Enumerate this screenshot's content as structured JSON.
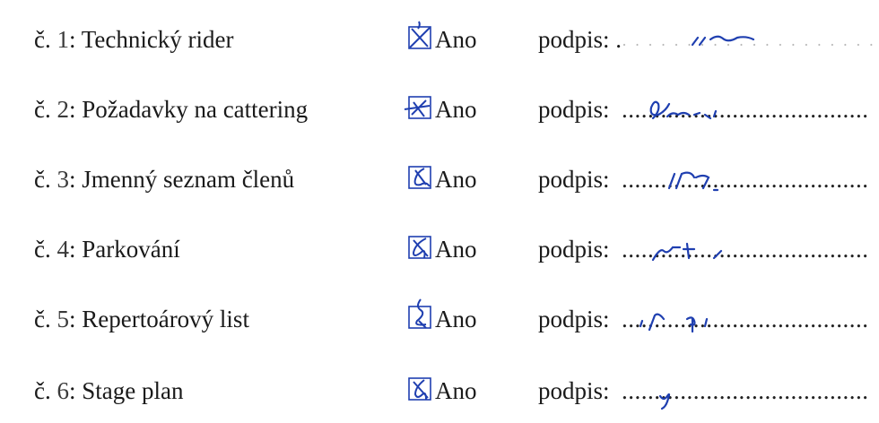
{
  "items": [
    {
      "prefix": "č. ",
      "number": "1",
      "title": ": Technický rider",
      "option": "Ano",
      "signature_label": "podpis: .",
      "dots": "· · · · · · · · · · · · · · · · · · · · · · · ·"
    },
    {
      "prefix": "č. ",
      "number": "2",
      "title": ": Požadavky na cattering",
      "option": "Ano",
      "signature_label": "podpis:",
      "dots": "......................................"
    },
    {
      "prefix": "č. ",
      "number": "3",
      "title": ": Jmenný seznam členů",
      "option": "Ano",
      "signature_label": "podpis:",
      "dots": "......................................"
    },
    {
      "prefix": "č. ",
      "number": "4",
      "title": ": Parkování",
      "option": "Ano",
      "signature_label": "podpis:",
      "dots": "......................................"
    },
    {
      "prefix": "č. ",
      "number": "5",
      "title": ": Repertoárový list",
      "option": "Ano",
      "signature_label": "podpis:",
      "dots": "......................................"
    },
    {
      "prefix": "č. ",
      "number": "6",
      "title": ": Stage plan",
      "option": "Ano",
      "signature_label": "podpis:",
      "dots": "......................................"
    }
  ],
  "colors": {
    "ink": "#1f3fb0",
    "text": "#1a1a1a"
  },
  "icons": {
    "checkbox": "checked-checkbox-icon",
    "signature": "handwritten-signature"
  }
}
